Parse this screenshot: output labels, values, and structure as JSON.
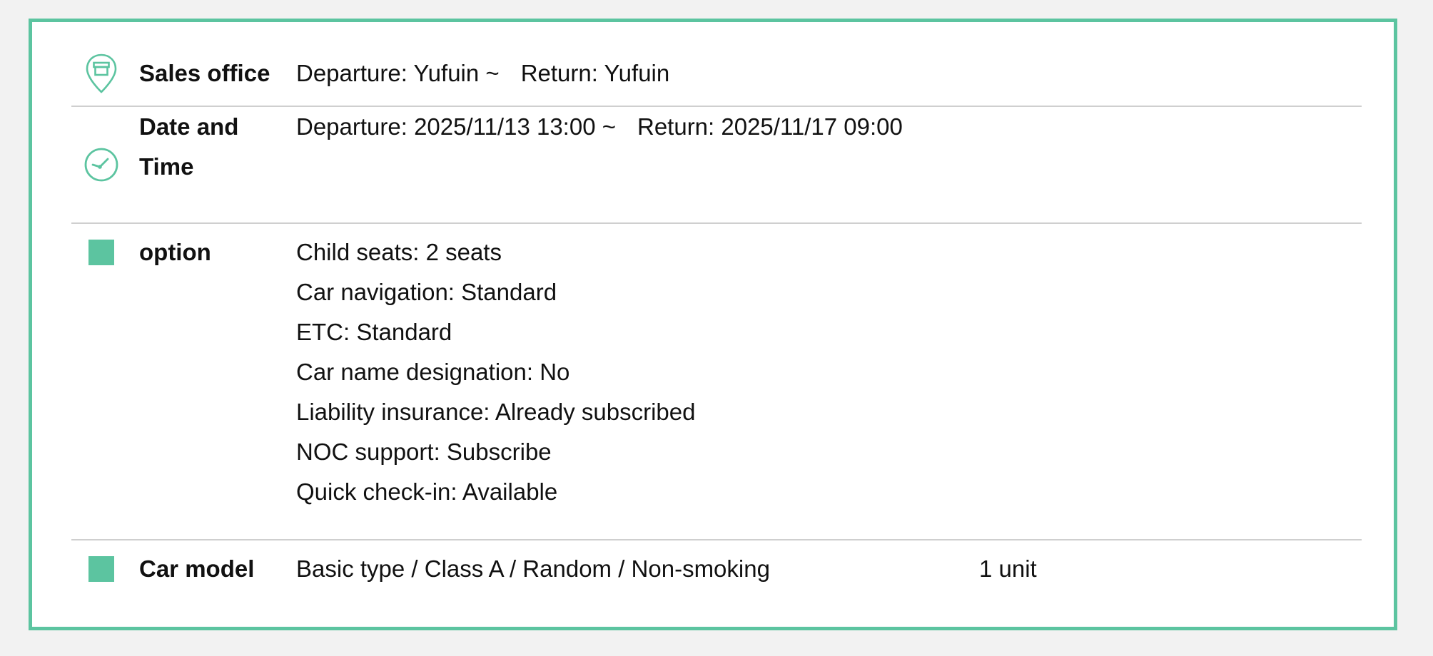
{
  "sections": {
    "sales_office": {
      "label": "Sales office",
      "departure": "Departure: Yufuin ~",
      "return": "Return: Yufuin",
      "icon": "map-pin-store-icon"
    },
    "date_time": {
      "label_line1": "Date and",
      "label_line2": "Time",
      "departure": "Departure: 2025/11/13 13:00 ~",
      "return": "Return: 2025/11/17 09:00",
      "icon": "clock-icon"
    },
    "option": {
      "label": "option",
      "items": [
        "Child seats: 2 seats",
        "Car navigation: Standard",
        "ETC: Standard",
        "Car name designation: No",
        "Liability insurance: Already subscribed",
        "NOC support: Subscribe",
        "Quick check-in: Available"
      ],
      "icon": "square-bullet-icon"
    },
    "car_model": {
      "label": "Car model",
      "value": "Basic type / Class A / Random / Non-smoking",
      "quantity": "1 unit",
      "icon": "square-bullet-icon"
    }
  },
  "colors": {
    "accent": "#5cc4a0",
    "border": "#5cc4a0",
    "divider": "#cfcfcf",
    "background": "#f2f2f2",
    "panel": "#ffffff",
    "text": "#111111"
  }
}
